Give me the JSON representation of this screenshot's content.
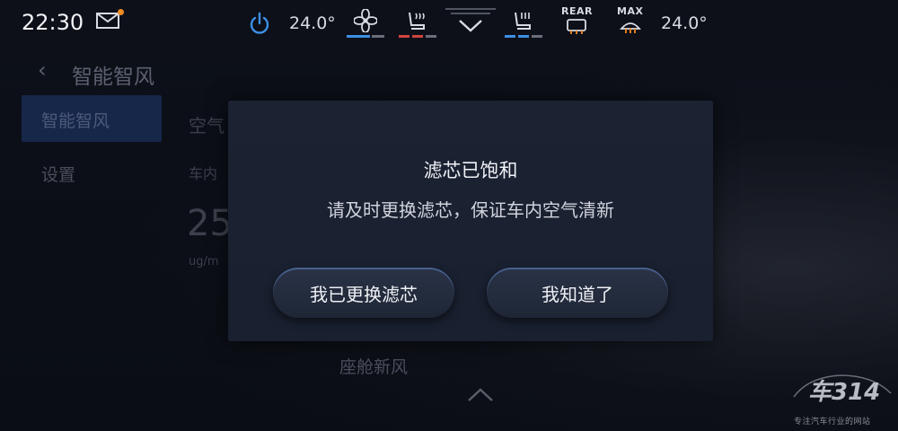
{
  "status_bar": {
    "time": "22:30",
    "temp_left": "24.0°",
    "temp_right": "24.0°",
    "rear_label": "REAR",
    "max_label": "MAX",
    "icons": [
      "mail-icon",
      "power-icon",
      "fan-icon",
      "seat-heat-icon",
      "chevron-down-icon",
      "seat-vent-icon",
      "rear-defrost-icon",
      "max-defrost-icon"
    ],
    "notification_color": "#f08a24",
    "accent_color": "#3d8fe6"
  },
  "background": {
    "page_title": "智能智风",
    "sidebar": [
      {
        "label": "智能智风",
        "selected": true
      },
      {
        "label": "设置",
        "selected": false
      }
    ],
    "frag_a": "空气",
    "frag_b": "车内",
    "frag_value": "25",
    "frag_unit": "ug/m",
    "bottom_label": "座舱新风"
  },
  "dialog": {
    "title": "滤芯已饱和",
    "message": "请及时更换滤芯，保证车内空气清新",
    "buttons": [
      {
        "label": "我已更换滤芯"
      },
      {
        "label": "我知道了"
      }
    ]
  },
  "watermark": {
    "logo": "车314",
    "tagline": "专注汽车行业的网站"
  }
}
